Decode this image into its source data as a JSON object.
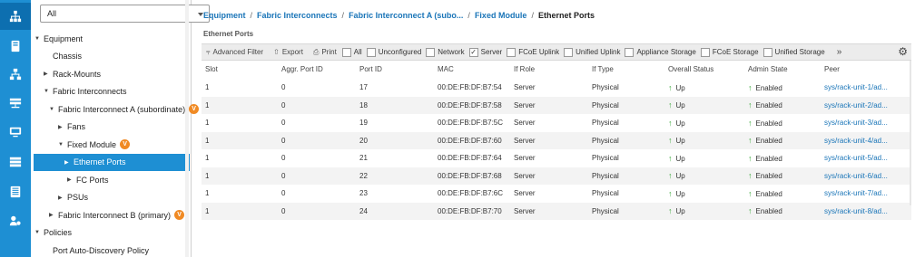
{
  "nav_filter": {
    "value": "All"
  },
  "tree": [
    {
      "label": "Equipment",
      "twisty": "▼",
      "indent": 0,
      "badge": false,
      "selected": false
    },
    {
      "label": "Chassis",
      "twisty": "",
      "indent": 1,
      "badge": false,
      "selected": false
    },
    {
      "label": "Rack-Mounts",
      "twisty": "▶",
      "indent": 1,
      "badge": false,
      "selected": false
    },
    {
      "label": "Fabric Interconnects",
      "twisty": "▼",
      "indent": 1,
      "badge": false,
      "selected": false
    },
    {
      "label": "Fabric Interconnect A (subordinate)",
      "twisty": "▼",
      "indent": 2,
      "badge": true,
      "selected": false
    },
    {
      "label": "Fans",
      "twisty": "▶",
      "indent": 3,
      "badge": false,
      "selected": false
    },
    {
      "label": "Fixed Module",
      "twisty": "▼",
      "indent": 3,
      "badge": true,
      "selected": false
    },
    {
      "label": "Ethernet Ports",
      "twisty": "▶",
      "indent": 4,
      "badge": false,
      "selected": true
    },
    {
      "label": "FC Ports",
      "twisty": "▶",
      "indent": 4,
      "badge": false,
      "selected": false
    },
    {
      "label": "PSUs",
      "twisty": "▶",
      "indent": 3,
      "badge": false,
      "selected": false
    },
    {
      "label": "Fabric Interconnect B (primary)",
      "twisty": "▶",
      "indent": 2,
      "badge": true,
      "selected": false
    },
    {
      "label": "Policies",
      "twisty": "▼",
      "indent": 0,
      "badge": false,
      "selected": false
    },
    {
      "label": "Port Auto-Discovery Policy",
      "twisty": "",
      "indent": 1,
      "badge": false,
      "selected": false
    }
  ],
  "badge_glyph": "V",
  "breadcrumb": {
    "items": [
      "Equipment",
      "Fabric Interconnects",
      "Fabric Interconnect A (subo...",
      "Fixed Module"
    ],
    "current": "Ethernet Ports",
    "separator": "/"
  },
  "section_title": "Ethernet Ports",
  "toolbar": {
    "advanced_filter": "Advanced Filter",
    "export": "Export",
    "print": "Print",
    "filters": [
      {
        "label": "All",
        "checked": false
      },
      {
        "label": "Unconfigured",
        "checked": false
      },
      {
        "label": "Network",
        "checked": false
      },
      {
        "label": "Server",
        "checked": true
      },
      {
        "label": "FCoE Uplink",
        "checked": false
      },
      {
        "label": "Unified Uplink",
        "checked": false
      },
      {
        "label": "Appliance Storage",
        "checked": false
      },
      {
        "label": "FCoE Storage",
        "checked": false
      },
      {
        "label": "Unified Storage",
        "checked": false
      }
    ],
    "more": "»"
  },
  "table": {
    "columns": [
      "Slot",
      "Aggr. Port ID",
      "Port ID",
      "MAC",
      "If Role",
      "If Type",
      "Overall Status",
      "Admin State",
      "Peer"
    ],
    "rows": [
      [
        "1",
        "0",
        "17",
        "00:DE:FB:DF:B7:54",
        "Server",
        "Physical",
        "Up",
        "Enabled",
        "sys/rack-unit-1/ad..."
      ],
      [
        "1",
        "0",
        "18",
        "00:DE:FB:DF:B7:58",
        "Server",
        "Physical",
        "Up",
        "Enabled",
        "sys/rack-unit-2/ad..."
      ],
      [
        "1",
        "0",
        "19",
        "00:DE:FB:DF:B7:5C",
        "Server",
        "Physical",
        "Up",
        "Enabled",
        "sys/rack-unit-3/ad..."
      ],
      [
        "1",
        "0",
        "20",
        "00:DE:FB:DF:B7:60",
        "Server",
        "Physical",
        "Up",
        "Enabled",
        "sys/rack-unit-4/ad..."
      ],
      [
        "1",
        "0",
        "21",
        "00:DE:FB:DF:B7:64",
        "Server",
        "Physical",
        "Up",
        "Enabled",
        "sys/rack-unit-5/ad..."
      ],
      [
        "1",
        "0",
        "22",
        "00:DE:FB:DF:B7:68",
        "Server",
        "Physical",
        "Up",
        "Enabled",
        "sys/rack-unit-6/ad..."
      ],
      [
        "1",
        "0",
        "23",
        "00:DE:FB:DF:B7:6C",
        "Server",
        "Physical",
        "Up",
        "Enabled",
        "sys/rack-unit-7/ad..."
      ],
      [
        "1",
        "0",
        "24",
        "00:DE:FB:DF:B7:70",
        "Server",
        "Physical",
        "Up",
        "Enabled",
        "sys/rack-unit-8/ad..."
      ]
    ]
  },
  "colors": {
    "rail": "#1e8fd3",
    "accent": "#1a75b8",
    "status_up": "#3aa83a",
    "badge": "#f08a24"
  }
}
